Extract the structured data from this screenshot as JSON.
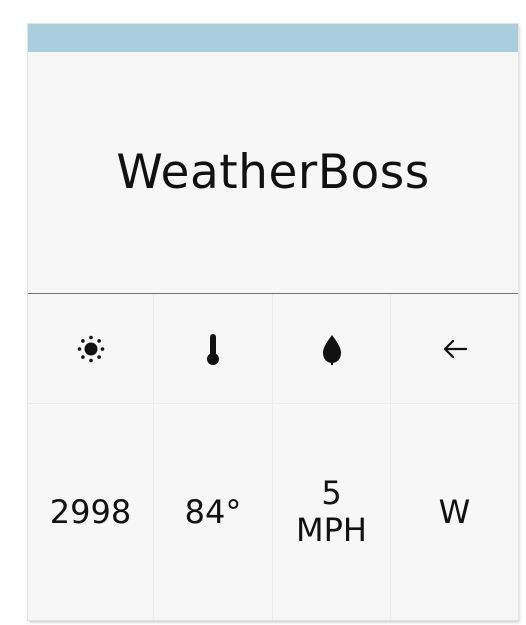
{
  "app": {
    "title": "WeatherBoss",
    "accent_color": "#a9cfdc"
  },
  "stats": [
    {
      "icon": "sun-icon",
      "value": "2998"
    },
    {
      "icon": "thermometer-icon",
      "value": "84°"
    },
    {
      "icon": "drop-icon",
      "value": "5\nMPH"
    },
    {
      "icon": "arrow-left-icon",
      "value": "W"
    }
  ]
}
